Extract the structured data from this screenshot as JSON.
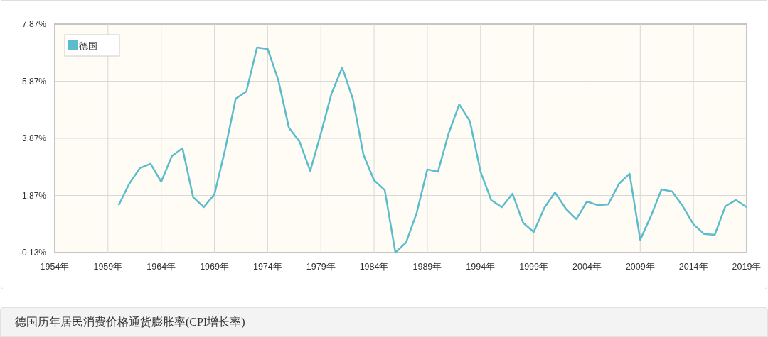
{
  "chart": {
    "chart_data": {
      "type": "line",
      "x": [
        1960,
        1961,
        1962,
        1963,
        1964,
        1965,
        1966,
        1967,
        1968,
        1969,
        1970,
        1971,
        1972,
        1973,
        1974,
        1975,
        1976,
        1977,
        1978,
        1979,
        1980,
        1981,
        1982,
        1983,
        1984,
        1985,
        1986,
        1987,
        1988,
        1989,
        1990,
        1991,
        1992,
        1993,
        1994,
        1995,
        1996,
        1997,
        1998,
        1999,
        2000,
        2001,
        2002,
        2003,
        2004,
        2005,
        2006,
        2007,
        2008,
        2009,
        2010,
        2011,
        2012,
        2013,
        2014,
        2015,
        2016,
        2017,
        2018,
        2019
      ],
      "series": [
        {
          "name": "德国",
          "color": "#5bbccc",
          "values": [
            1.53,
            2.28,
            2.83,
            2.98,
            2.35,
            3.25,
            3.52,
            1.81,
            1.46,
            1.91,
            3.47,
            5.26,
            5.51,
            7.05,
            7.0,
            5.91,
            4.24,
            3.75,
            2.73,
            4.04,
            5.44,
            6.35,
            5.26,
            3.3,
            2.4,
            2.06,
            -0.13,
            0.22,
            1.26,
            2.78,
            2.7,
            4.04,
            5.06,
            4.47,
            2.7,
            1.71,
            1.46,
            1.93,
            0.91,
            0.59,
            1.44,
            1.98,
            1.41,
            1.04,
            1.66,
            1.53,
            1.56,
            2.28,
            2.63,
            0.32,
            1.14,
            2.08,
            2.01,
            1.49,
            0.86,
            0.52,
            0.49,
            1.49,
            1.71,
            1.46
          ]
        }
      ],
      "grid": true,
      "xlim": [
        1954,
        2019
      ],
      "ylim": [
        -0.13,
        7.87
      ],
      "xticks": [
        {
          "value": 1954,
          "label": "1954年"
        },
        {
          "value": 1959,
          "label": "1959年"
        },
        {
          "value": 1964,
          "label": "1964年"
        },
        {
          "value": 1969,
          "label": "1969年"
        },
        {
          "value": 1974,
          "label": "1974年"
        },
        {
          "value": 1979,
          "label": "1979年"
        },
        {
          "value": 1984,
          "label": "1984年"
        },
        {
          "value": 1989,
          "label": "1989年"
        },
        {
          "value": 1994,
          "label": "1994年"
        },
        {
          "value": 1999,
          "label": "1999年"
        },
        {
          "value": 2004,
          "label": "2004年"
        },
        {
          "value": 2009,
          "label": "2009年"
        },
        {
          "value": 2014,
          "label": "2014年"
        },
        {
          "value": 2019,
          "label": "2019年"
        }
      ],
      "yticks": [
        {
          "value": -0.13,
          "label": "-0.13%"
        },
        {
          "value": 1.87,
          "label": "1.87%"
        },
        {
          "value": 3.87,
          "label": "3.87%"
        },
        {
          "value": 5.87,
          "label": "5.87%"
        },
        {
          "value": 7.87,
          "label": "7.87%"
        }
      ]
    }
  },
  "caption": {
    "title": "德国历年居民消费价格通货膨胀率(CPI增长率)"
  }
}
